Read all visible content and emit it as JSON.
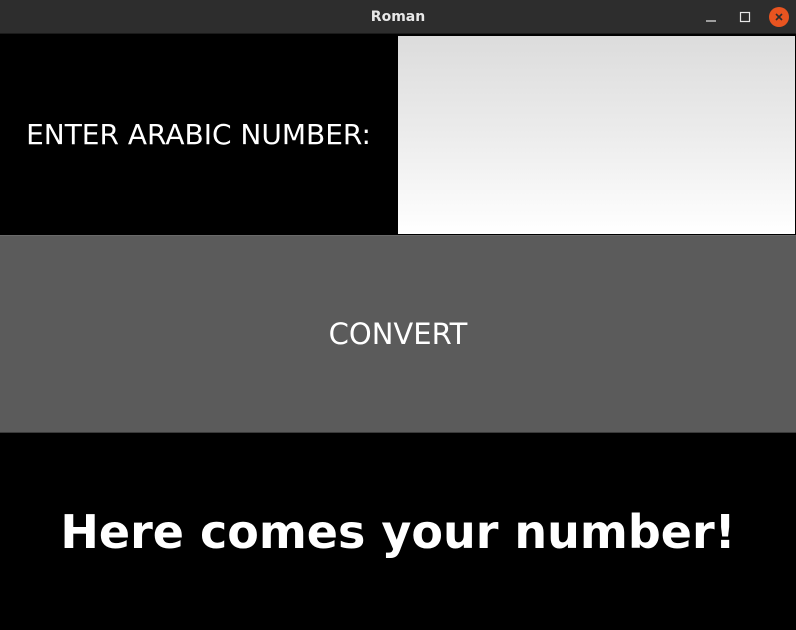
{
  "window": {
    "title": "Roman",
    "controls": {
      "minimize_icon": "minimize-icon",
      "maximize_icon": "maximize-icon",
      "close_icon": "close-icon"
    },
    "close_color": "#e95420"
  },
  "form": {
    "label": "ENTER ARABIC NUMBER:",
    "input_value": "",
    "input_placeholder": ""
  },
  "convert_button": {
    "label": "CONVERT",
    "background": "#5b5b5b"
  },
  "result": {
    "text": "Here comes your number!"
  }
}
